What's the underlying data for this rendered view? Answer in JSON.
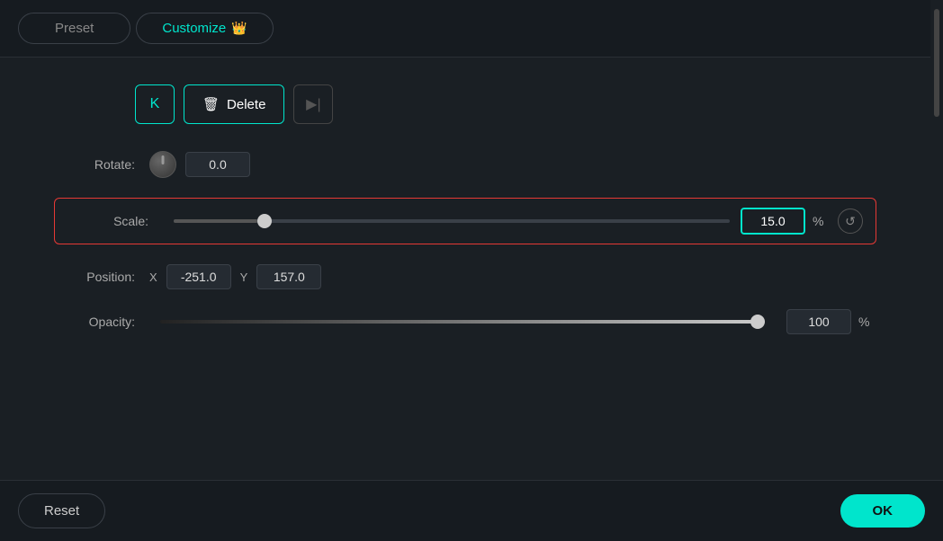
{
  "tabs": {
    "preset_label": "Preset",
    "customize_label": "Customize",
    "crown_emoji": "👑"
  },
  "buttons": {
    "k_label": "K",
    "delete_label": "Delete",
    "next_label": "▶|",
    "reset_label": "Reset",
    "ok_label": "OK"
  },
  "rotate": {
    "label": "Rotate:",
    "value": "0.0"
  },
  "scale": {
    "label": "Scale:",
    "value": "15.0",
    "percent": "%",
    "fill_percent": 15,
    "thumb_left_percent": 15
  },
  "position": {
    "label": "Position:",
    "x_label": "X",
    "x_value": "-251.0",
    "y_label": "Y",
    "y_value": "157.0"
  },
  "opacity": {
    "label": "Opacity:",
    "value": "100",
    "percent": "%"
  }
}
